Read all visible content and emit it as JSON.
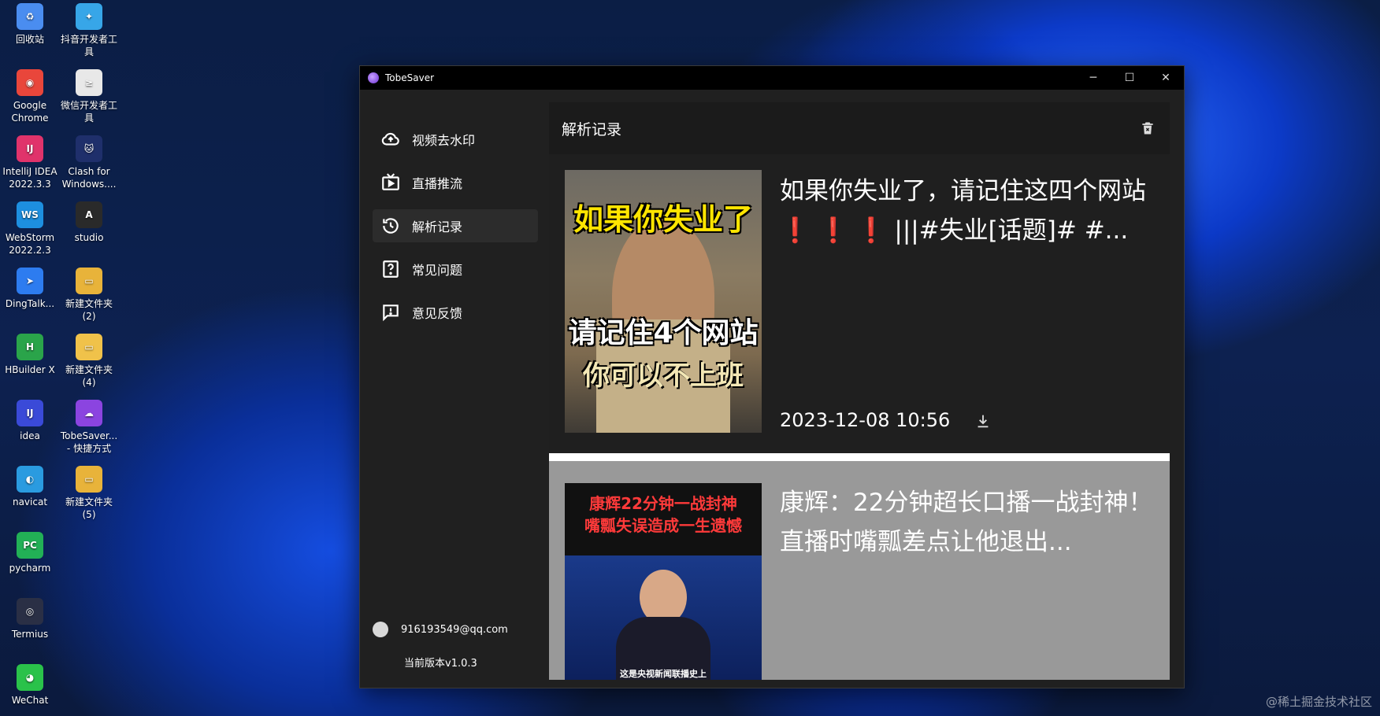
{
  "desktop": {
    "icons": [
      {
        "label": "回收站",
        "color": "#4a8df0",
        "glyph": "♻"
      },
      {
        "label": "抖音开发者工\n具",
        "color": "#37a6e8",
        "glyph": "✦"
      },
      {
        "label": "Google\nChrome",
        "color": "#e9463b",
        "glyph": "◉"
      },
      {
        "label": "微信开发者工\n具",
        "color": "#e8e8e8",
        "glyph": "≥"
      },
      {
        "label": "IntelliJ IDEA\n2022.3.3",
        "color": "#e0336b",
        "glyph": "IJ"
      },
      {
        "label": "Clash for\nWindows....",
        "color": "#1f2f6b",
        "glyph": "🐱"
      },
      {
        "label": "WebStorm\n2022.2.3",
        "color": "#1d8fe0",
        "glyph": "WS"
      },
      {
        "label": "studio",
        "color": "#2a2a2a",
        "glyph": "A"
      },
      {
        "label": "DingTalk...",
        "color": "#2d7cf0",
        "glyph": "➤"
      },
      {
        "label": "新建文件夹\n(2)",
        "color": "#e8b33a",
        "glyph": "▭"
      },
      {
        "label": "HBuilder X",
        "color": "#2aa44a",
        "glyph": "H"
      },
      {
        "label": "新建文件夹\n(4)",
        "color": "#f0c24a",
        "glyph": "▭"
      },
      {
        "label": "idea",
        "color": "#3a4ad8",
        "glyph": "IJ"
      },
      {
        "label": "TobeSaver...\n- 快捷方式",
        "color": "#8b44e0",
        "glyph": "☁"
      },
      {
        "label": "navicat",
        "color": "#2a9be0",
        "glyph": "◐"
      },
      {
        "label": "新建文件夹\n(5)",
        "color": "#e8b33a",
        "glyph": "▭"
      },
      {
        "label": "pycharm",
        "color": "#22b056",
        "glyph": "PC"
      },
      {
        "label": "Termius",
        "color": "#2a2f45",
        "glyph": "◎"
      },
      {
        "label": "WeChat",
        "color": "#2ac24a",
        "glyph": "◕"
      }
    ]
  },
  "window": {
    "title": "TobeSaver",
    "minimize": "─",
    "maximize": "☐",
    "close": "✕"
  },
  "sidebar": {
    "items": [
      {
        "label": "视频去水印"
      },
      {
        "label": "直播推流"
      },
      {
        "label": "解析记录"
      },
      {
        "label": "常见问题"
      },
      {
        "label": "意见反馈"
      }
    ],
    "user_email": "916193549@qq.com",
    "version": "当前版本v1.0.3"
  },
  "main": {
    "header_title": "解析记录",
    "records": [
      {
        "title_a": "如果你失业了，请记住这四个网站",
        "title_marks": "❗ ❗ ❗",
        "title_b": "|||#失业[话题]# #...",
        "time": "2023-12-08 10:56",
        "thumb_caption_top": "如果你失业了",
        "thumb_caption_mid": "请记住4个网站",
        "thumb_caption_bottom": "你可以不上班"
      },
      {
        "title": "康辉：22分钟超长口播一战封神！直播时嘴瓢差点让他退出...",
        "thumb_caption_top": "康辉22分钟一战封神",
        "thumb_caption_sub": "嘴瓢失误造成一生遗憾",
        "thumb_caption_bottom": "这是央视新闻联播史上"
      }
    ]
  },
  "watermark": "@稀土掘金技术社区",
  "colors": {
    "accent": "#8b44e0",
    "window_bg": "#202020",
    "titlebar": "#000000"
  }
}
